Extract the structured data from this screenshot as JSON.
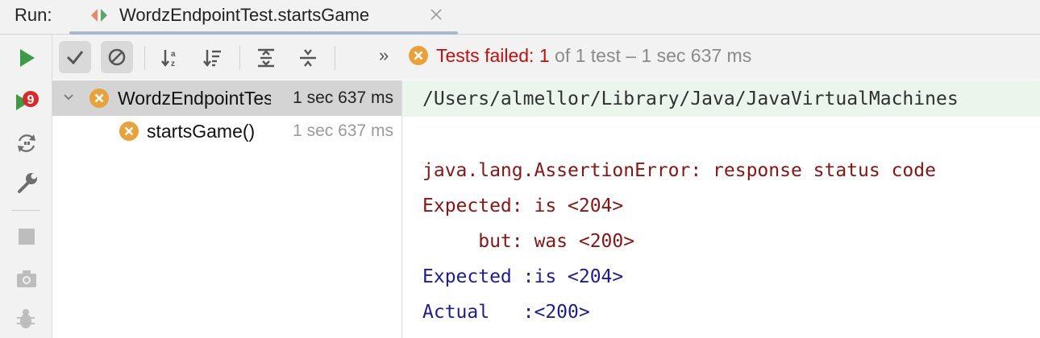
{
  "tabbar": {
    "run_label": "Run:",
    "tab_title": "WordzEndpointTest.startsGame"
  },
  "toolbar": {
    "chevrons": "»",
    "status_failed": "Tests failed: 1",
    "status_rest": " of 1 test – 1 sec 637 ms"
  },
  "tree": {
    "items": [
      {
        "label": "WordzEndpointTest",
        "time": "1 sec 637 ms",
        "status": "failed"
      },
      {
        "label": "startsGame()",
        "time": "1 sec 637 ms",
        "status": "failed"
      }
    ]
  },
  "console": {
    "lines": [
      "/Users/almellor/Library/Java/JavaVirtualMachines",
      "java.lang.AssertionError: response status code",
      "Expected: is <204>",
      "     but: was <200>",
      "Expected :is <204>",
      "Actual   :<200>"
    ]
  },
  "colors": {
    "run_green": "#3d9b46",
    "fail_orange": "#e9a23b",
    "fail_text": "#c01010",
    "console_red": "#861515",
    "console_blue": "#1d1d8b"
  },
  "icons": {
    "tab": "test-run-icon",
    "close": "close-icon",
    "run": "run-icon",
    "rerun_failed": "rerun-failed-icon",
    "toggle_auto_test": "toggle-auto-test-icon",
    "settings": "wrench-icon",
    "stop": "stop-icon",
    "screenshot": "camera-icon",
    "debug": "bug-icon",
    "show_passed": "check-icon",
    "show_ignored": "ignored-icon",
    "sort_alpha": "sort-alpha-icon",
    "sort_duration": "sort-duration-icon",
    "expand_all": "expand-all-icon",
    "collapse_all": "collapse-all-icon"
  }
}
